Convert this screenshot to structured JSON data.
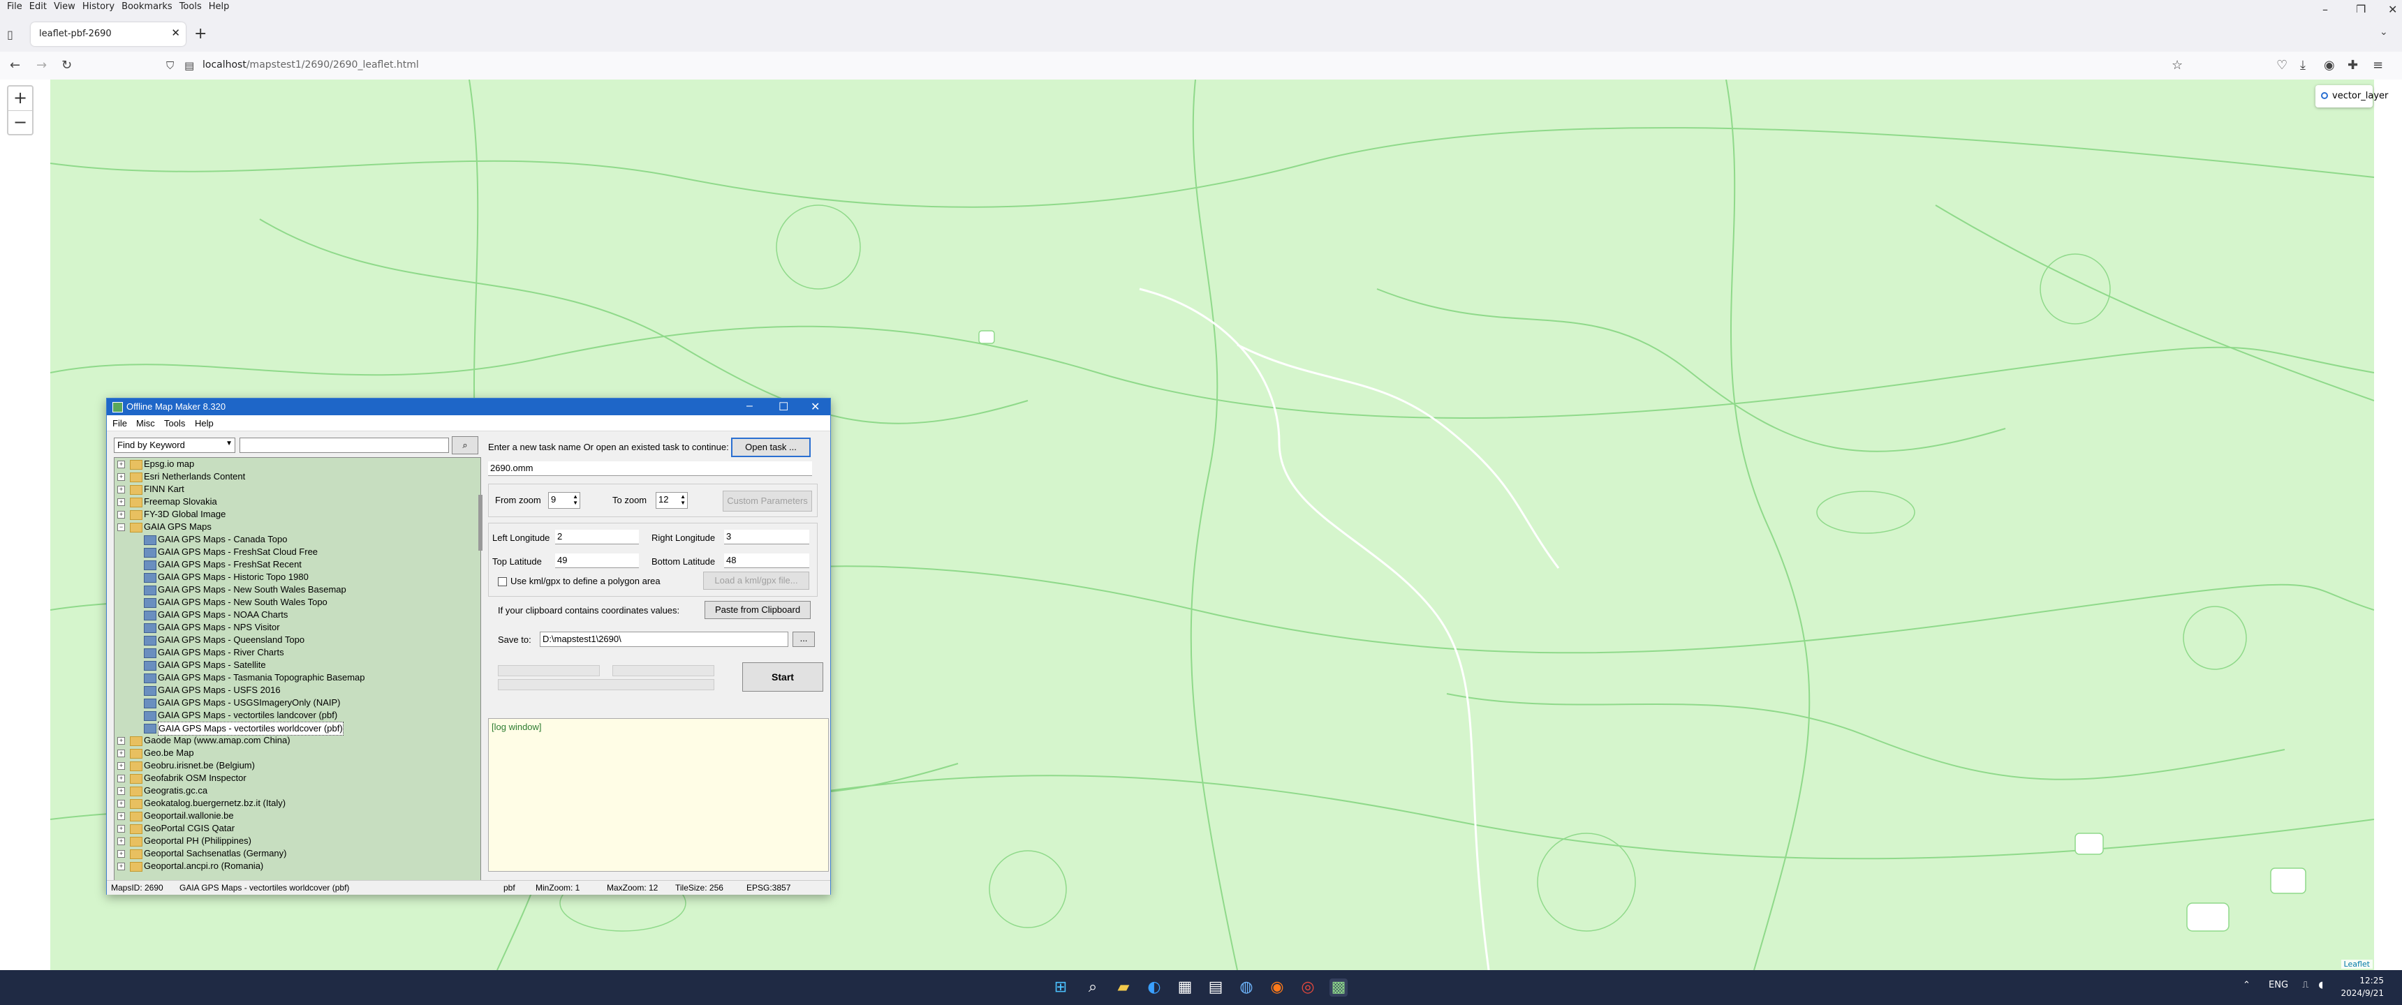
{
  "browser": {
    "menu": [
      "File",
      "Edit",
      "View",
      "History",
      "Bookmarks",
      "Tools",
      "Help"
    ],
    "tab_title": "leaflet-pbf-2690",
    "url_host": "localhost",
    "url_path": "/mapstest1/2690/2690_leaflet.html"
  },
  "map": {
    "zoom_in": "+",
    "zoom_out": "−",
    "layer_name": "vector_layer",
    "attribution": "Leaflet",
    "colors": {
      "land": "#d5f5cc",
      "lines": "#8fd98a"
    }
  },
  "app": {
    "title": "Offline Map Maker 8.320",
    "menu": [
      "File",
      "Misc",
      "Tools",
      "Help"
    ],
    "search_mode": "Find by Keyword",
    "search_value": "",
    "tree": [
      {
        "label": "Epsg.io map",
        "type": "folder"
      },
      {
        "label": "Esri Netherlands Content",
        "type": "folder"
      },
      {
        "label": "FINN Kart",
        "type": "folder"
      },
      {
        "label": "Freemap Slovakia",
        "type": "folder"
      },
      {
        "label": "FY-3D Global Image",
        "type": "folder"
      },
      {
        "label": "GAIA GPS Maps",
        "type": "open"
      },
      {
        "label": "GAIA GPS Maps - Canada Topo",
        "type": "leaf"
      },
      {
        "label": "GAIA GPS Maps - FreshSat Cloud Free",
        "type": "leaf"
      },
      {
        "label": "GAIA GPS Maps - FreshSat Recent",
        "type": "leaf"
      },
      {
        "label": "GAIA GPS Maps - Historic Topo 1980",
        "type": "leaf"
      },
      {
        "label": "GAIA GPS Maps - New South Wales Basemap",
        "type": "leaf"
      },
      {
        "label": "GAIA GPS Maps - New South Wales Topo",
        "type": "leaf"
      },
      {
        "label": "GAIA GPS Maps - NOAA Charts",
        "type": "leaf"
      },
      {
        "label": "GAIA GPS Maps - NPS Visitor",
        "type": "leaf"
      },
      {
        "label": "GAIA GPS Maps - Queensland Topo",
        "type": "leaf"
      },
      {
        "label": "GAIA GPS Maps - River Charts",
        "type": "leaf"
      },
      {
        "label": "GAIA GPS Maps - Satellite",
        "type": "leaf"
      },
      {
        "label": "GAIA GPS Maps - Tasmania Topographic Basemap",
        "type": "leaf"
      },
      {
        "label": "GAIA GPS Maps - USFS 2016",
        "type": "leaf"
      },
      {
        "label": "GAIA GPS Maps - USGSImageryOnly (NAIP)",
        "type": "leaf"
      },
      {
        "label": "GAIA GPS Maps - vectortiles landcover (pbf)",
        "type": "leaf"
      },
      {
        "label": "GAIA GPS Maps - vectortiles worldcover (pbf)",
        "type": "leaf",
        "selected": true
      },
      {
        "label": "Gaode Map (www.amap.com China)",
        "type": "folder"
      },
      {
        "label": "Geo.be Map",
        "type": "folder"
      },
      {
        "label": "Geobru.irisnet.be (Belgium)",
        "type": "folder"
      },
      {
        "label": "Geofabrik OSM Inspector",
        "type": "folder"
      },
      {
        "label": "Geogratis.gc.ca",
        "type": "folder"
      },
      {
        "label": "Geokatalog.buergernetz.bz.it (Italy)",
        "type": "folder"
      },
      {
        "label": "Geoportail.wallonie.be",
        "type": "folder"
      },
      {
        "label": "GeoPortal CGIS Qatar",
        "type": "folder"
      },
      {
        "label": "Geoportal PH (Philippines)",
        "type": "folder"
      },
      {
        "label": "Geoportal Sachsenatlas (Germany)",
        "type": "folder"
      },
      {
        "label": "Geoportal.ancpi.ro (Romania)",
        "type": "folder"
      }
    ],
    "task_prompt": "Enter a new task name Or open an existed task to continue:",
    "open_task_btn": "Open task ...",
    "task_name": "2690.omm",
    "from_zoom_label": "From zoom",
    "from_zoom": "9",
    "to_zoom_label": "To zoom",
    "to_zoom": "12",
    "custom_params_btn": "Custom Parameters",
    "left_lon_label": "Left Longitude",
    "left_lon": "2",
    "right_lon_label": "Right Longitude",
    "right_lon": "3",
    "top_lat_label": "Top Latitude",
    "top_lat": "49",
    "bottom_lat_label": "Bottom Latitude",
    "bottom_lat": "48",
    "kml_label": "Use kml/gpx to define a polygon area",
    "load_kml_btn": "Load a kml/gpx file...",
    "clipboard_label": "If your clipboard contains coordinates values:",
    "paste_btn": "Paste from Clipboard",
    "save_to_label": "Save to:",
    "save_to": "D:\\mapstest1\\2690\\",
    "browse_btn": "...",
    "start_btn": "Start",
    "log_text": "[log window]",
    "status": {
      "maps_id": "MapsID: 2690",
      "map_name": "GAIA GPS Maps - vectortiles worldcover (pbf)",
      "format": "pbf",
      "min_zoom": "MinZoom: 1",
      "max_zoom": "MaxZoom: 12",
      "tile_size": "TileSize: 256",
      "epsg": "EPSG:3857"
    }
  },
  "taskbar": {
    "lang": "ENG",
    "time": "12:25",
    "date": "2024/9/21"
  }
}
